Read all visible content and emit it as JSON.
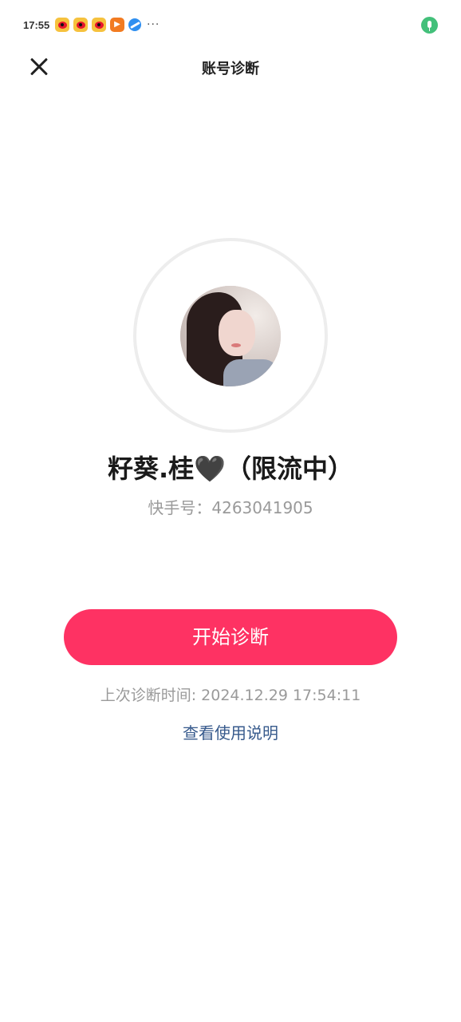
{
  "status_bar": {
    "time": "17:55",
    "icons": [
      "weibo-icon",
      "weibo-icon",
      "weibo-icon",
      "video-play-icon",
      "browser-icon"
    ],
    "more": "···"
  },
  "nav": {
    "title": "账号诊断"
  },
  "profile": {
    "name": "籽葵.桂🖤（限流中）",
    "id_label": "快手号：",
    "id_value": "4263041905"
  },
  "actions": {
    "start_label": "开始诊断",
    "last_time_label": "上次诊断时间: ",
    "last_time_value": "2024.12.29 17:54:11",
    "help_link": "查看使用说明"
  },
  "colors": {
    "primary": "#fe3263",
    "link": "#375a8c",
    "muted": "#9a9a9a"
  }
}
